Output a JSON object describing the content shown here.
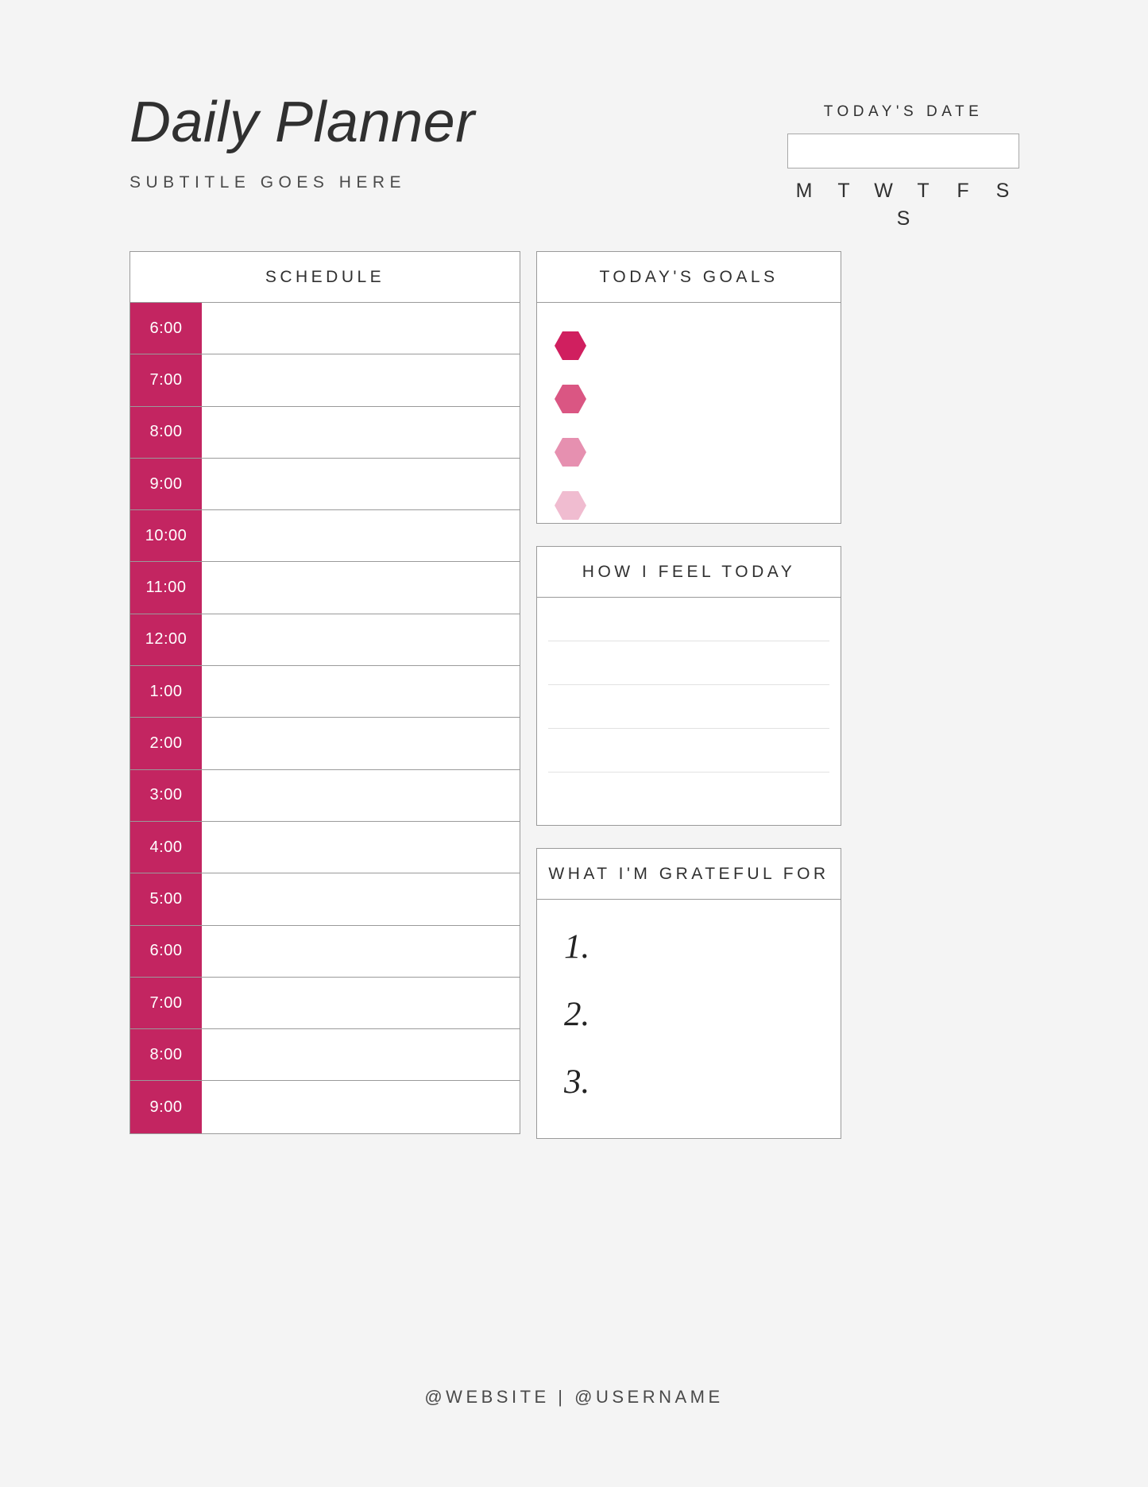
{
  "header": {
    "title": "Daily Planner",
    "subtitle": "SUBTITLE GOES HERE",
    "date_label": "TODAY'S DATE",
    "date_value": "",
    "date_placeholder": "",
    "days_row1": [
      "M",
      "T",
      "W",
      "T",
      "F",
      "S"
    ],
    "days_row2": [
      "S"
    ]
  },
  "schedule": {
    "header": "SCHEDULE",
    "rows": [
      {
        "time": "6:00",
        "entry": ""
      },
      {
        "time": "7:00",
        "entry": ""
      },
      {
        "time": "8:00",
        "entry": ""
      },
      {
        "time": "9:00",
        "entry": ""
      },
      {
        "time": "10:00",
        "entry": ""
      },
      {
        "time": "11:00",
        "entry": ""
      },
      {
        "time": "12:00",
        "entry": ""
      },
      {
        "time": "1:00",
        "entry": ""
      },
      {
        "time": "2:00",
        "entry": ""
      },
      {
        "time": "3:00",
        "entry": ""
      },
      {
        "time": "4:00",
        "entry": ""
      },
      {
        "time": "5:00",
        "entry": ""
      },
      {
        "time": "6:00",
        "entry": ""
      },
      {
        "time": "7:00",
        "entry": ""
      },
      {
        "time": "8:00",
        "entry": ""
      },
      {
        "time": "9:00",
        "entry": ""
      }
    ]
  },
  "goals": {
    "header": "TODAY'S GOALS",
    "items": [
      {
        "color": "#d01f5f",
        "text": ""
      },
      {
        "color": "#da5683",
        "text": ""
      },
      {
        "color": "#e690b0",
        "text": ""
      },
      {
        "color": "#f0bcd0",
        "text": ""
      }
    ]
  },
  "feelings": {
    "header": "HOW I FEEL TODAY",
    "line_count": 4,
    "text": ""
  },
  "grateful": {
    "header": "WHAT I'M GRATEFUL FOR",
    "items": [
      {
        "marker": "1.",
        "text": ""
      },
      {
        "marker": "2.",
        "text": ""
      },
      {
        "marker": "3.",
        "text": ""
      }
    ]
  },
  "footer": {
    "text": "@WEBSITE | @USERNAME"
  },
  "colors": {
    "accent": "#c32561",
    "background": "#f4f4f4",
    "border": "#9a9a9a",
    "panel": "#ffffff"
  }
}
